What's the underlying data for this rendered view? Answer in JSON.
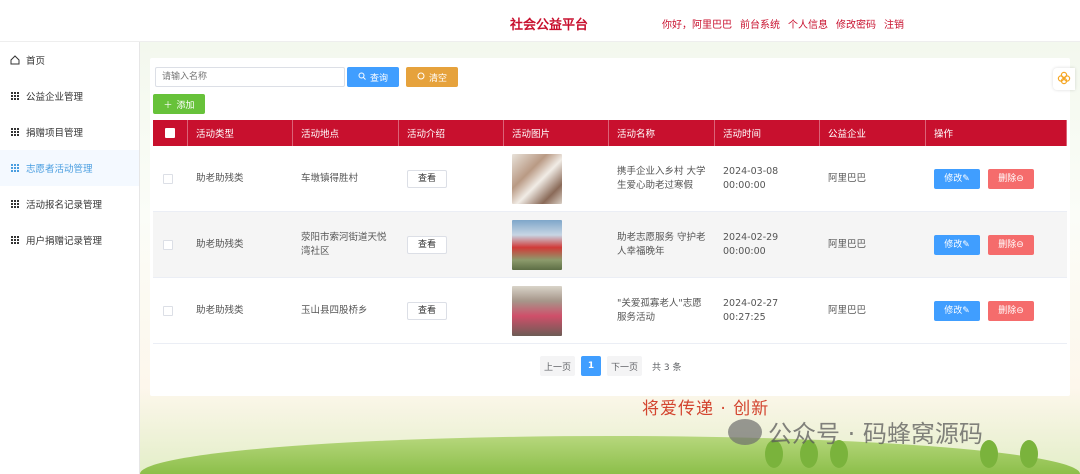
{
  "header": {
    "title": "社会公益平台",
    "greeting": "你好，阿里巴巴",
    "links": [
      "前台系统",
      "个人信息",
      "修改密码",
      "注销"
    ]
  },
  "sidebar": {
    "items": [
      {
        "label": "首页",
        "icon": "home-icon"
      },
      {
        "label": "公益企业管理",
        "icon": "grid-icon"
      },
      {
        "label": "捐赠项目管理",
        "icon": "grid-icon"
      },
      {
        "label": "志愿者活动管理",
        "icon": "grid-icon",
        "active": true
      },
      {
        "label": "活动报名记录管理",
        "icon": "grid-icon"
      },
      {
        "label": "用户捐赠记录管理",
        "icon": "grid-icon"
      }
    ]
  },
  "search": {
    "placeholder": "请输入名称",
    "query_label": "查询",
    "clear_label": "清空",
    "add_label": "添加"
  },
  "table": {
    "columns": [
      "",
      "活动类型",
      "活动地点",
      "活动介绍",
      "活动图片",
      "活动名称",
      "活动时间",
      "公益企业",
      "操作"
    ],
    "view_label": "查看",
    "edit_label": "修改",
    "delete_label": "删除",
    "rows": [
      {
        "type": "助老助残类",
        "location": "车墩镇得胜村",
        "name": "携手企业入乡村 大学生爱心助老过寒假",
        "time": "2024-03-08 00:00:00",
        "company": "阿里巴巴",
        "image": "photo-1"
      },
      {
        "type": "助老助残类",
        "location": "荥阳市索河街道天悦湾社区",
        "name": "助老志愿服务 守护老人幸福晚年",
        "time": "2024-02-29 00:00:00",
        "company": "阿里巴巴",
        "image": "photo-2"
      },
      {
        "type": "助老助残类",
        "location": "玉山县四股桥乡",
        "name": "\"关爱孤寡老人\"志愿服务活动",
        "time": "2024-02-27 00:27:25",
        "company": "阿里巴巴",
        "image": "photo-3"
      }
    ]
  },
  "pagination": {
    "prev_label": "上一页",
    "current_page": "1",
    "next_label": "下一页",
    "total_label": "共 3 条"
  },
  "background": {
    "slogan": "将爱传递 · 创新",
    "watermark": "公众号 · 码蜂窝源码"
  },
  "colors": {
    "brand": "#c8102e",
    "primary": "#409eff",
    "warning": "#e6a23c",
    "success": "#67c23a",
    "danger": "#f56c6c"
  }
}
